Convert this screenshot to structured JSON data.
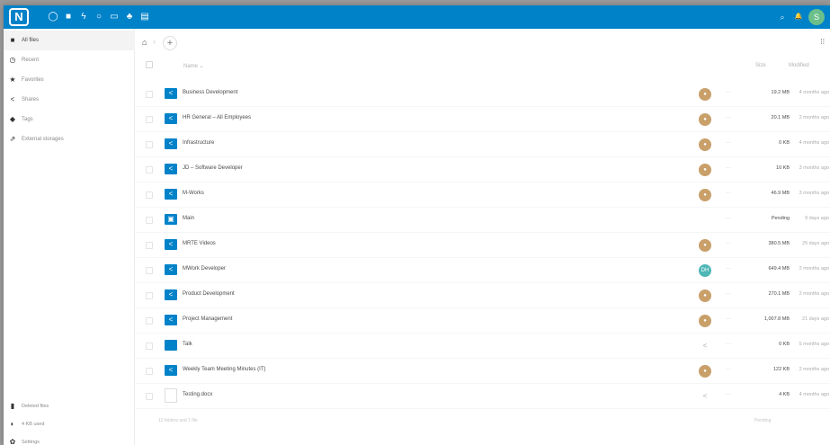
{
  "header": {
    "logo_text": "N",
    "apps": [
      {
        "icon": "dashboard-icon",
        "glyph": "◯"
      },
      {
        "icon": "folder-icon",
        "glyph": "■"
      },
      {
        "icon": "activity-icon",
        "glyph": "ϟ"
      },
      {
        "icon": "search-app-icon",
        "glyph": "○"
      },
      {
        "icon": "mail-icon",
        "glyph": "▭"
      },
      {
        "icon": "contacts-icon",
        "glyph": "♣"
      },
      {
        "icon": "calendar-icon",
        "glyph": "▤"
      }
    ],
    "search_glyph": "⌕",
    "notifications_glyph": "🔔",
    "user_initial": "S",
    "accent": "#0082c9"
  },
  "sidebar": {
    "items": [
      {
        "label": "All files",
        "icon": "folder-icon",
        "glyph": "■",
        "active": true
      },
      {
        "label": "Recent",
        "icon": "clock-icon",
        "glyph": "◷",
        "active": false
      },
      {
        "label": "Favorites",
        "icon": "star-icon",
        "glyph": "★",
        "active": false
      },
      {
        "label": "Shares",
        "icon": "share-icon",
        "glyph": "<",
        "active": false
      },
      {
        "label": "Tags",
        "icon": "tag-icon",
        "glyph": "◆",
        "active": false
      },
      {
        "label": "External storages",
        "icon": "external-storage-icon",
        "glyph": "⇗",
        "active": false
      }
    ],
    "bottom": [
      {
        "label": "Deleted files",
        "icon": "trash-icon",
        "glyph": "▮"
      },
      {
        "label": "4 KB used",
        "icon": "quota-icon",
        "glyph": "◐"
      },
      {
        "label": "Settings",
        "icon": "gear-icon",
        "glyph": "✿"
      }
    ]
  },
  "breadcrumb": {
    "home_glyph": "⌂",
    "chevron": "›",
    "add_glyph": "+",
    "view_glyph": "⁞⁞"
  },
  "table": {
    "headers": {
      "name": "Name ⌄",
      "size": "Size",
      "modified": "Modified"
    },
    "rows": [
      {
        "name": "Business Development",
        "type": "shared",
        "sharer": "avatar",
        "size": "19.2 MB",
        "modified": "4 months ago"
      },
      {
        "name": "HR General – All Employees",
        "type": "shared",
        "sharer": "avatar",
        "size": "20.1 MB",
        "modified": "2 months ago"
      },
      {
        "name": "Infrastructure",
        "type": "shared",
        "sharer": "avatar",
        "size": "0 KB",
        "modified": "4 months ago"
      },
      {
        "name": "JD – Software Developer",
        "type": "shared",
        "sharer": "avatar",
        "size": "10 KB",
        "modified": "3 months ago"
      },
      {
        "name": "M-Works",
        "type": "shared",
        "sharer": "avatar",
        "size": "46.9 MB",
        "modified": "3 months ago"
      },
      {
        "name": "Main",
        "type": "special",
        "sharer": "none",
        "size": "Pending",
        "modified": "9 days ago"
      },
      {
        "name": "MRTE Videos",
        "type": "shared",
        "sharer": "avatar",
        "size": "380.5 MB",
        "modified": "25 days ago"
      },
      {
        "name": "MWork Developer",
        "type": "shared",
        "sharer": "initials",
        "initials": "DH",
        "size": "649.4 MB",
        "modified": "2 months ago"
      },
      {
        "name": "Product Development",
        "type": "shared",
        "sharer": "avatar",
        "size": "270.1 MB",
        "modified": "2 months ago"
      },
      {
        "name": "Project Management",
        "type": "shared",
        "sharer": "avatar",
        "size": "1,007.8 MB",
        "modified": "21 days ago"
      },
      {
        "name": "Talk",
        "type": "folder",
        "sharer": "share-glyph",
        "size": "0 KB",
        "modified": "5 months ago"
      },
      {
        "name": "Weekly Team Meeting Minutes (IT)",
        "type": "shared",
        "sharer": "avatar",
        "size": "122 KB",
        "modified": "2 months ago"
      },
      {
        "name": "Testing.docx",
        "type": "doc",
        "sharer": "share-glyph",
        "size": "4 KB",
        "modified": "4 months ago"
      }
    ],
    "more_glyph": "···",
    "footer_summary": "12 folders and 1 file",
    "footer_pending": "Pending"
  }
}
